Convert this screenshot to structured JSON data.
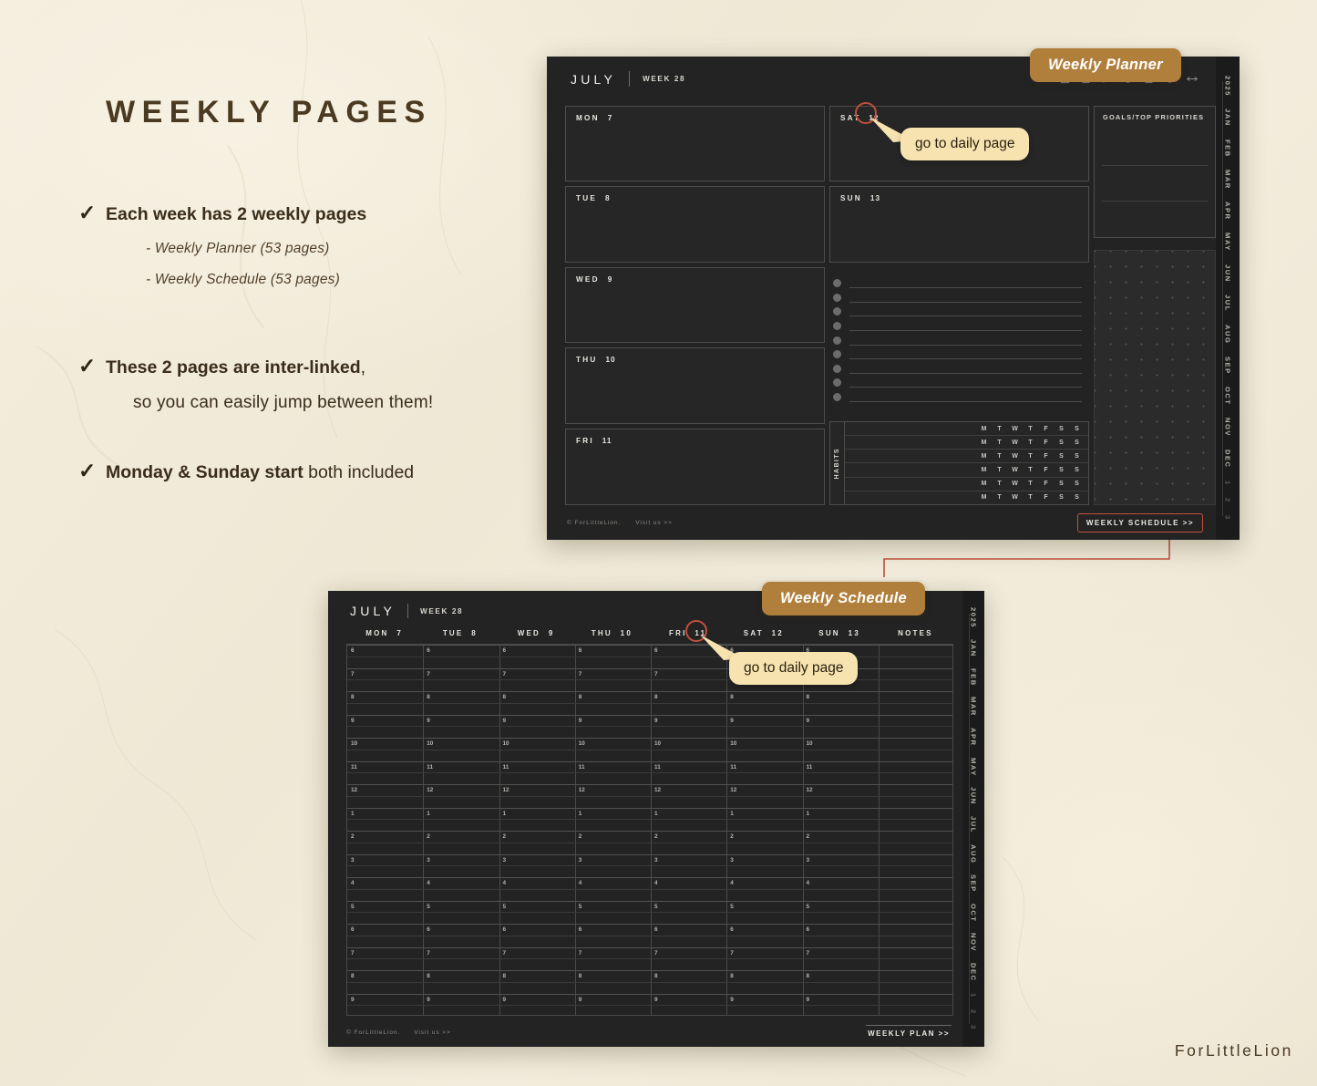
{
  "background": {
    "paper_color": "#efe9d8",
    "ink": "#3a2d1a"
  },
  "left": {
    "title": "WEEKLY PAGES",
    "bullets": [
      {
        "check": "✓",
        "text": "Each week has 2 weekly pages",
        "sub_items": [
          "- Weekly Planner (53 pages)",
          "- Weekly Schedule (53 pages)"
        ]
      },
      {
        "check": "✓",
        "text_bold": "These 2 pages are inter-linked",
        "text_tail": ",",
        "second_line": "so you can easily jump between them!"
      },
      {
        "check": "✓",
        "text_bold": "Monday & Sunday start",
        "text_reg": " both included"
      }
    ],
    "brand": "ForLittleLion"
  },
  "badges": {
    "planner": "Weekly Planner",
    "schedule": "Weekly Schedule",
    "color": "#b07f3c"
  },
  "bubbles": {
    "planner": "go to daily page",
    "schedule": "go to daily page",
    "color": "#f7e3b0"
  },
  "planner": {
    "month": "JULY",
    "week": "WEEK 28",
    "toolbar_icons": [
      "home-icon",
      "notebook-icon",
      "pen-icon",
      "clock-icon",
      "books-icon",
      "heart-icon",
      "arrows-icon"
    ],
    "left_days": [
      {
        "label": "MON",
        "num": "7"
      },
      {
        "label": "TUE",
        "num": "8"
      },
      {
        "label": "WED",
        "num": "9"
      },
      {
        "label": "THU",
        "num": "10"
      },
      {
        "label": "FRI",
        "num": "11"
      }
    ],
    "right_days": [
      {
        "label": "SAT",
        "num": "12"
      },
      {
        "label": "SUN",
        "num": "13"
      }
    ],
    "goals_title": "GOALS/TOP PRIORITIES",
    "habits_label": "HABITS",
    "habit_days": [
      "M",
      "T",
      "W",
      "T",
      "F",
      "S",
      "S"
    ],
    "habit_rows": 6,
    "checklist_rows": 9,
    "footer_copyright": "© ForLittleLion.",
    "footer_visit": "Visit us >>",
    "footer_button": "WEEKLY SCHEDULE >>",
    "rail": [
      "2025",
      "JAN",
      "FEB",
      "MAR",
      "APR",
      "MAY",
      "JUN",
      "JUL",
      "AUG",
      "SEP",
      "OCT",
      "NOV",
      "DEC",
      "1",
      "2",
      "3"
    ]
  },
  "schedule": {
    "month": "JULY",
    "week": "WEEK 28",
    "columns": [
      {
        "label": "MON",
        "num": "7"
      },
      {
        "label": "TUE",
        "num": "8"
      },
      {
        "label": "WED",
        "num": "9"
      },
      {
        "label": "THU",
        "num": "10"
      },
      {
        "label": "FRI",
        "num": "11"
      },
      {
        "label": "SAT",
        "num": "12"
      },
      {
        "label": "SUN",
        "num": "13"
      }
    ],
    "notes_column": "NOTES",
    "hours": [
      "6",
      "7",
      "8",
      "9",
      "10",
      "11",
      "12",
      "1",
      "2",
      "3",
      "4",
      "5",
      "6",
      "7",
      "8",
      "9"
    ],
    "footer_copyright": "© ForLittleLion.",
    "footer_visit": "Visit us >>",
    "footer_button": "WEEKLY PLAN >>",
    "rail": [
      "2025",
      "JAN",
      "FEB",
      "MAR",
      "APR",
      "MAY",
      "JUN",
      "JUL",
      "AUG",
      "SEP",
      "OCT",
      "NOV",
      "DEC",
      "1",
      "2",
      "3"
    ]
  }
}
